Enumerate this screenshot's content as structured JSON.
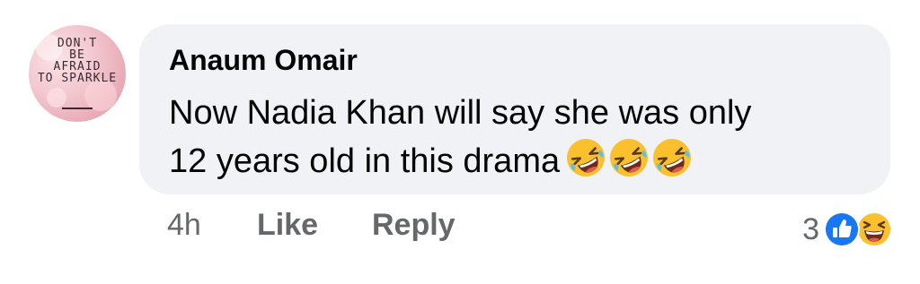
{
  "comment": {
    "avatar_lines": [
      "DON'T",
      "BE",
      "AFRAID",
      "TO SPARKLE"
    ],
    "author": "Anaum Omair",
    "text_line_1": "Now Nadia Khan will say she was only",
    "text_line_2": "12 years old in this drama",
    "emojis": [
      "rolling-on-floor-laughing",
      "rolling-on-floor-laughing",
      "rolling-on-floor-laughing"
    ]
  },
  "actions": {
    "time": "4h",
    "like_label": "Like",
    "reply_label": "Reply"
  },
  "reactions": {
    "count": "3",
    "icons": [
      "like-reaction-icon",
      "haha-reaction-icon"
    ]
  },
  "colors": {
    "bubble_bg": "#f0f2f5",
    "secondary_text": "#65676b",
    "like_blue": "#1877f2",
    "emoji_yellow": "#fbc02d"
  }
}
